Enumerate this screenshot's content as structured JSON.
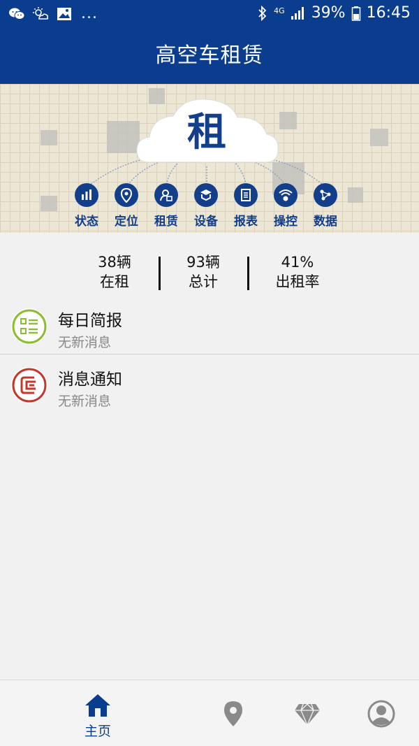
{
  "status_bar": {
    "notification_icons": [
      "wechat-icon",
      "cloud-sun-icon",
      "image-icon"
    ],
    "more": "...",
    "network": "4G",
    "battery": "39%",
    "time": "16:45"
  },
  "header": {
    "title": "高空车租赁"
  },
  "banner": {
    "logo_char": "租",
    "functions": [
      {
        "label": "状态",
        "icon": "bar-chart-icon"
      },
      {
        "label": "定位",
        "icon": "location-pin-icon"
      },
      {
        "label": "租赁",
        "icon": "rental-icon"
      },
      {
        "label": "设备",
        "icon": "equipment-icon"
      },
      {
        "label": "报表",
        "icon": "report-icon"
      },
      {
        "label": "操控",
        "icon": "wireless-control-icon"
      },
      {
        "label": "数据",
        "icon": "data-network-icon"
      }
    ]
  },
  "stats": [
    {
      "value": "38辆",
      "label": "在租"
    },
    {
      "value": "93辆",
      "label": "总计"
    },
    {
      "value": "41%",
      "label": "出租率"
    }
  ],
  "messages": [
    {
      "title": "每日简报",
      "subtitle": "无新消息",
      "icon": "daily-report-icon",
      "color": "#8cbd2e"
    },
    {
      "title": "消息通知",
      "subtitle": "无新消息",
      "icon": "notification-icon",
      "color": "#c0392b"
    }
  ],
  "tabbar": {
    "items": [
      {
        "label": "主页",
        "icon": "home-icon",
        "active": true
      },
      {
        "label": "",
        "icon": "location-pin-icon",
        "active": false
      },
      {
        "label": "",
        "icon": "diamond-icon",
        "active": false
      },
      {
        "label": "",
        "icon": "user-icon",
        "active": false
      }
    ]
  },
  "colors": {
    "primary": "#0b3d8f",
    "icon_gray": "#8a8a8a"
  }
}
